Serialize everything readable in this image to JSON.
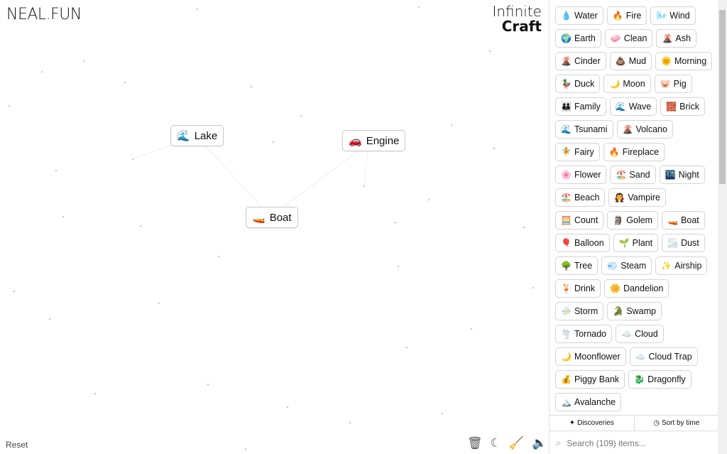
{
  "logo": "NEAL.FUN",
  "title": {
    "line1": "Infinite",
    "line2": "Craft"
  },
  "canvas": {
    "elements": [
      {
        "label": "Lake",
        "icon": "🌊"
      },
      {
        "label": "Engine",
        "icon": "🚗"
      },
      {
        "label": "Boat",
        "icon": "🚤"
      }
    ]
  },
  "footer": {
    "reset": "Reset",
    "tools": [
      "trash-icon",
      "moon-icon",
      "broom-icon",
      "sound-icon"
    ]
  },
  "sidebar": {
    "items": [
      {
        "icon": "💧",
        "label": "Water"
      },
      {
        "icon": "🔥",
        "label": "Fire"
      },
      {
        "icon": "🌬️",
        "label": "Wind"
      },
      {
        "icon": "🌍",
        "label": "Earth"
      },
      {
        "icon": "🧼",
        "label": "Clean"
      },
      {
        "icon": "🌋",
        "label": "Ash"
      },
      {
        "icon": "🌋",
        "label": "Cinder"
      },
      {
        "icon": "💩",
        "label": "Mud"
      },
      {
        "icon": "🌞",
        "label": "Morning"
      },
      {
        "icon": "🦆",
        "label": "Duck"
      },
      {
        "icon": "🌙",
        "label": "Moon"
      },
      {
        "icon": "🐷",
        "label": "Pig"
      },
      {
        "icon": "👪",
        "label": "Family"
      },
      {
        "icon": "🌊",
        "label": "Wave"
      },
      {
        "icon": "🧱",
        "label": "Brick"
      },
      {
        "icon": "🌊",
        "label": "Tsunami"
      },
      {
        "icon": "🌋",
        "label": "Volcano"
      },
      {
        "icon": "🧚",
        "label": "Fairy"
      },
      {
        "icon": "🔥",
        "label": "Fireplace"
      },
      {
        "icon": "🌸",
        "label": "Flower"
      },
      {
        "icon": "🏖️",
        "label": "Sand"
      },
      {
        "icon": "🌃",
        "label": "Night"
      },
      {
        "icon": "🏖️",
        "label": "Beach"
      },
      {
        "icon": "🧛",
        "label": "Vampire"
      },
      {
        "icon": "🧮",
        "label": "Count"
      },
      {
        "icon": "🗿",
        "label": "Golem"
      },
      {
        "icon": "🚤",
        "label": "Boat"
      },
      {
        "icon": "🎈",
        "label": "Balloon"
      },
      {
        "icon": "🌱",
        "label": "Plant"
      },
      {
        "icon": "🌫️",
        "label": "Dust"
      },
      {
        "icon": "🌳",
        "label": "Tree"
      },
      {
        "icon": "💨",
        "label": "Steam"
      },
      {
        "icon": "✨",
        "label": "Airship"
      },
      {
        "icon": "🍹",
        "label": "Drink"
      },
      {
        "icon": "🌼",
        "label": "Dandelion"
      },
      {
        "icon": "⛈️",
        "label": "Storm"
      },
      {
        "icon": "🐊",
        "label": "Swamp"
      },
      {
        "icon": "🌪️",
        "label": "Tornado"
      },
      {
        "icon": "☁️",
        "label": "Cloud"
      },
      {
        "icon": "🌙",
        "label": "Moonflower"
      },
      {
        "icon": "☁️",
        "label": "Cloud Trap"
      },
      {
        "icon": "💰",
        "label": "Piggy Bank"
      },
      {
        "icon": "🐉",
        "label": "Dragonfly"
      },
      {
        "icon": "🏔️",
        "label": "Avalanche"
      }
    ],
    "discoveries": "Discoveries",
    "sort": "Sort by time",
    "search_placeholder": "Search (109) items..."
  }
}
